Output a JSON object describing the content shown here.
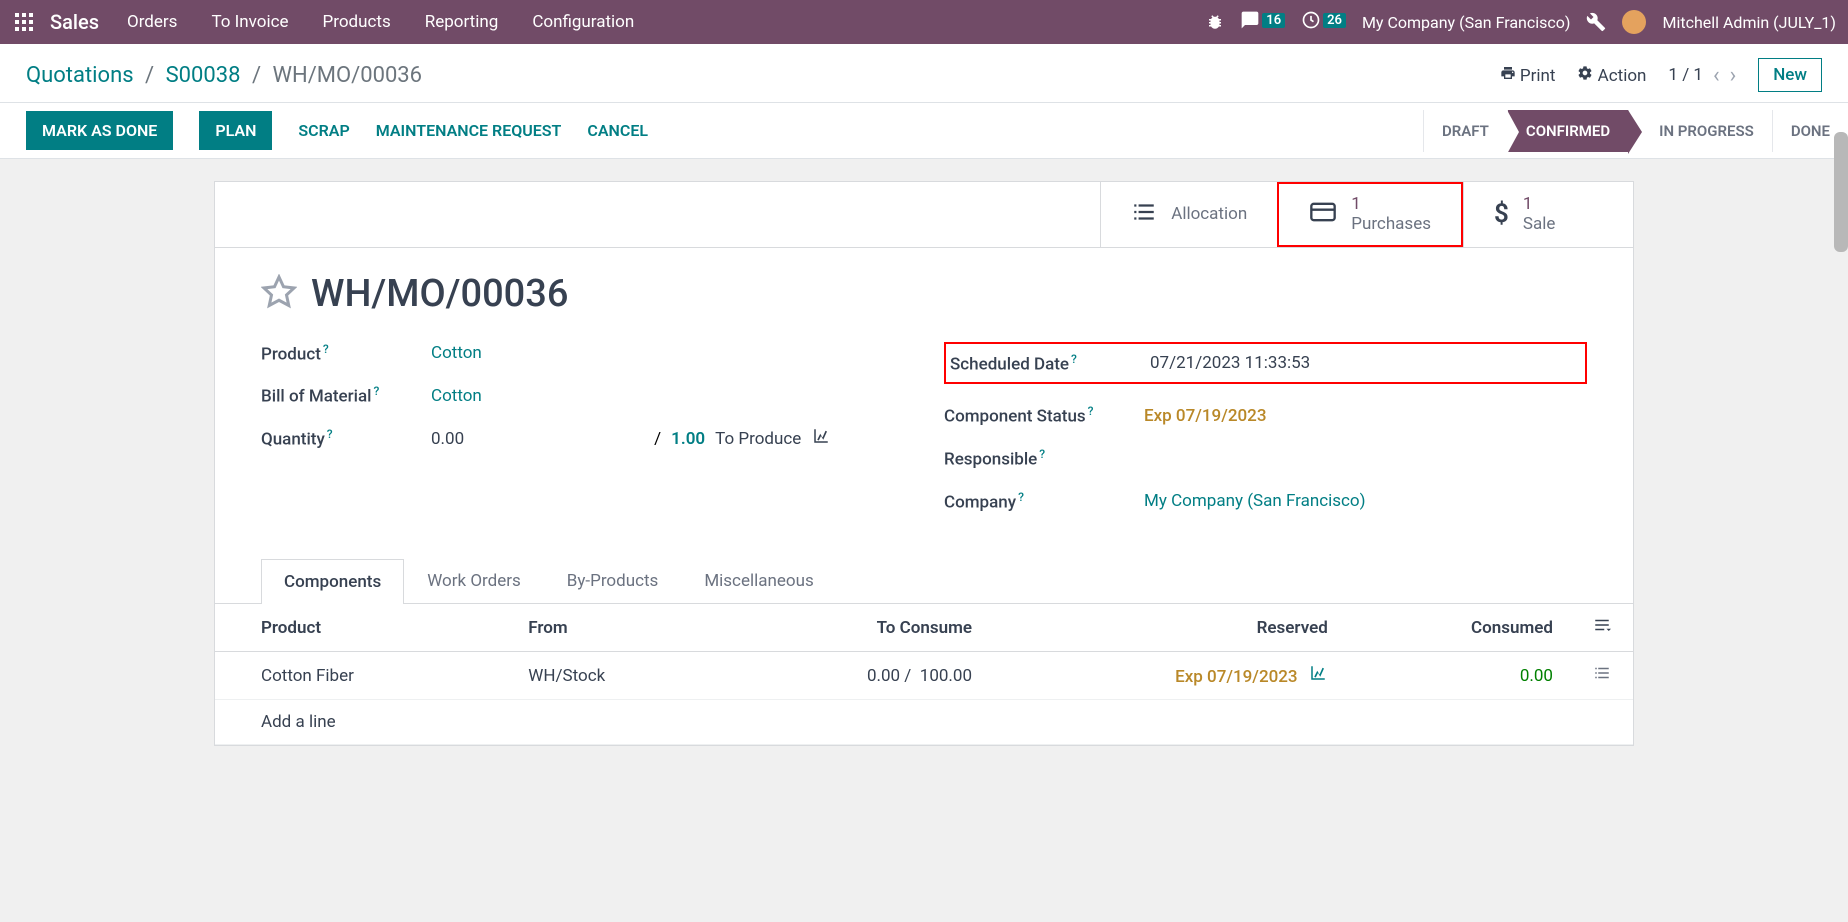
{
  "topbar": {
    "brand": "Sales",
    "menu": [
      "Orders",
      "To Invoice",
      "Products",
      "Reporting",
      "Configuration"
    ],
    "msg_badge": "16",
    "act_badge": "26",
    "company": "My Company (San Francisco)",
    "user": "Mitchell Admin (JULY_1)"
  },
  "controlbar": {
    "crumb1": "Quotations",
    "crumb2": "S00038",
    "crumb3": "WH/MO/00036",
    "print": "Print",
    "action": "Action",
    "pager": "1 / 1",
    "new": "New"
  },
  "statusbar": {
    "mark_done": "MARK AS DONE",
    "plan": "PLAN",
    "scrap": "SCRAP",
    "maintenance": "MAINTENANCE REQUEST",
    "cancel": "CANCEL",
    "stages": [
      "DRAFT",
      "CONFIRMED",
      "IN PROGRESS",
      "DONE"
    ]
  },
  "stats": {
    "allocation": "Allocation",
    "purchases_n": "1",
    "purchases_l": "Purchases",
    "sale_n": "1",
    "sale_l": "Sale"
  },
  "form": {
    "title": "WH/MO/00036",
    "product_l": "Product",
    "product_v": "Cotton",
    "bom_l": "Bill of Material",
    "bom_v": "Cotton",
    "qty_l": "Quantity",
    "qty_v": "0.00",
    "qty_sep": "/",
    "qty_tot": "1.00",
    "qty_suffix": "To Produce",
    "sched_l": "Scheduled Date",
    "sched_v": "07/21/2023 11:33:53",
    "comp_l": "Component Status",
    "comp_v": "Exp 07/19/2023",
    "resp_l": "Responsible",
    "company_l": "Company",
    "company_v": "My Company (San Francisco)"
  },
  "tabs": [
    "Components",
    "Work Orders",
    "By-Products",
    "Miscellaneous"
  ],
  "table": {
    "h_product": "Product",
    "h_from": "From",
    "h_consume": "To Consume",
    "h_reserved": "Reserved",
    "h_consumed": "Consumed",
    "row": {
      "product": "Cotton Fiber",
      "from": "WH/Stock",
      "to_consume_a": "0.00 /",
      "to_consume_b": "100.00",
      "reserved": "Exp 07/19/2023",
      "consumed": "0.00"
    },
    "addline": "Add a line"
  }
}
